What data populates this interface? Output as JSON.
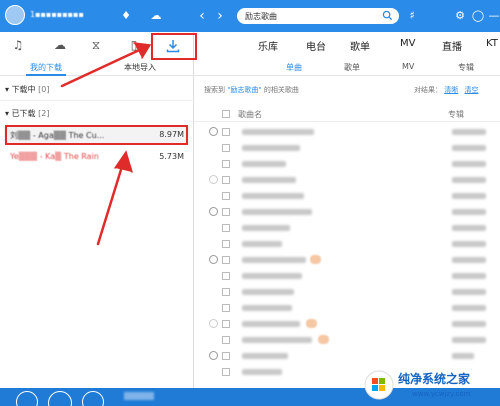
{
  "app": {
    "username": "1▪▪▪▪▪▪▪▪▪"
  },
  "search": {
    "query": "励志歌曲"
  },
  "left_nav": {
    "icons": [
      "music-note-icon",
      "cloud-icon",
      "radio-icon",
      "phone-icon",
      "download-icon"
    ]
  },
  "left_tabs": {
    "my_downloads": "我的下载",
    "local_import": "本地导入"
  },
  "downloading": {
    "label": "下载中",
    "count": "[0]"
  },
  "downloaded": {
    "label": "已下载",
    "count": "[2]",
    "items": [
      {
        "title": "刘▒▒ - Aga▒▒ The Cu...",
        "size": "8.97M"
      },
      {
        "title": "Ye▒▒▒ - Ka▒ The Rain",
        "size": "5.73M"
      }
    ]
  },
  "top_nav": {
    "items": [
      "乐库",
      "电台",
      "歌单",
      "MV",
      "直播",
      "KT"
    ]
  },
  "result_tabs": {
    "items": [
      "单曲",
      "歌单",
      "MV",
      "专辑"
    ]
  },
  "info": {
    "prefix": "搜索到",
    "keyword": "\"励志歌曲\"",
    "suffix": "的相关歌曲",
    "filter_label": "对结果：",
    "filter_a": "清晰",
    "filter_b": "清空"
  },
  "table": {
    "col_song": "歌曲名",
    "col_album": "专辑"
  },
  "watermark": {
    "title": "纯净系统之家",
    "url": "www.ycwjzy.com"
  }
}
